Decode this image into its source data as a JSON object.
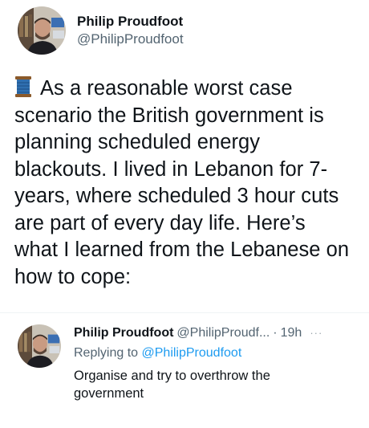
{
  "tweet": {
    "author_name": "Philip Proudfoot",
    "author_handle": "@PhilipProudfoot",
    "thread_icon": "thread-spool-icon",
    "lines": [
      "As a reasonable worst case",
      "scenario the British government is",
      "planning scheduled energy",
      "blackouts. I lived in Lebanon for 7-",
      "years, where scheduled 3 hour cuts",
      "are part of every day life. Here’s",
      "what I learned from the Lebanese on",
      "how to cope:"
    ]
  },
  "reply": {
    "author_name": "Philip Proudfoot",
    "author_handle": "@PhilipProudf...",
    "separator": "·",
    "time": "19h",
    "more": "···",
    "replying_prefix": "Replying to",
    "replying_to": "@PhilipProudfoot",
    "text_lines": [
      "Organise and try to overthrow the",
      "government"
    ]
  },
  "colors": {
    "text": "#0f1419",
    "secondary": "#536471",
    "link": "#1d9bf0"
  }
}
